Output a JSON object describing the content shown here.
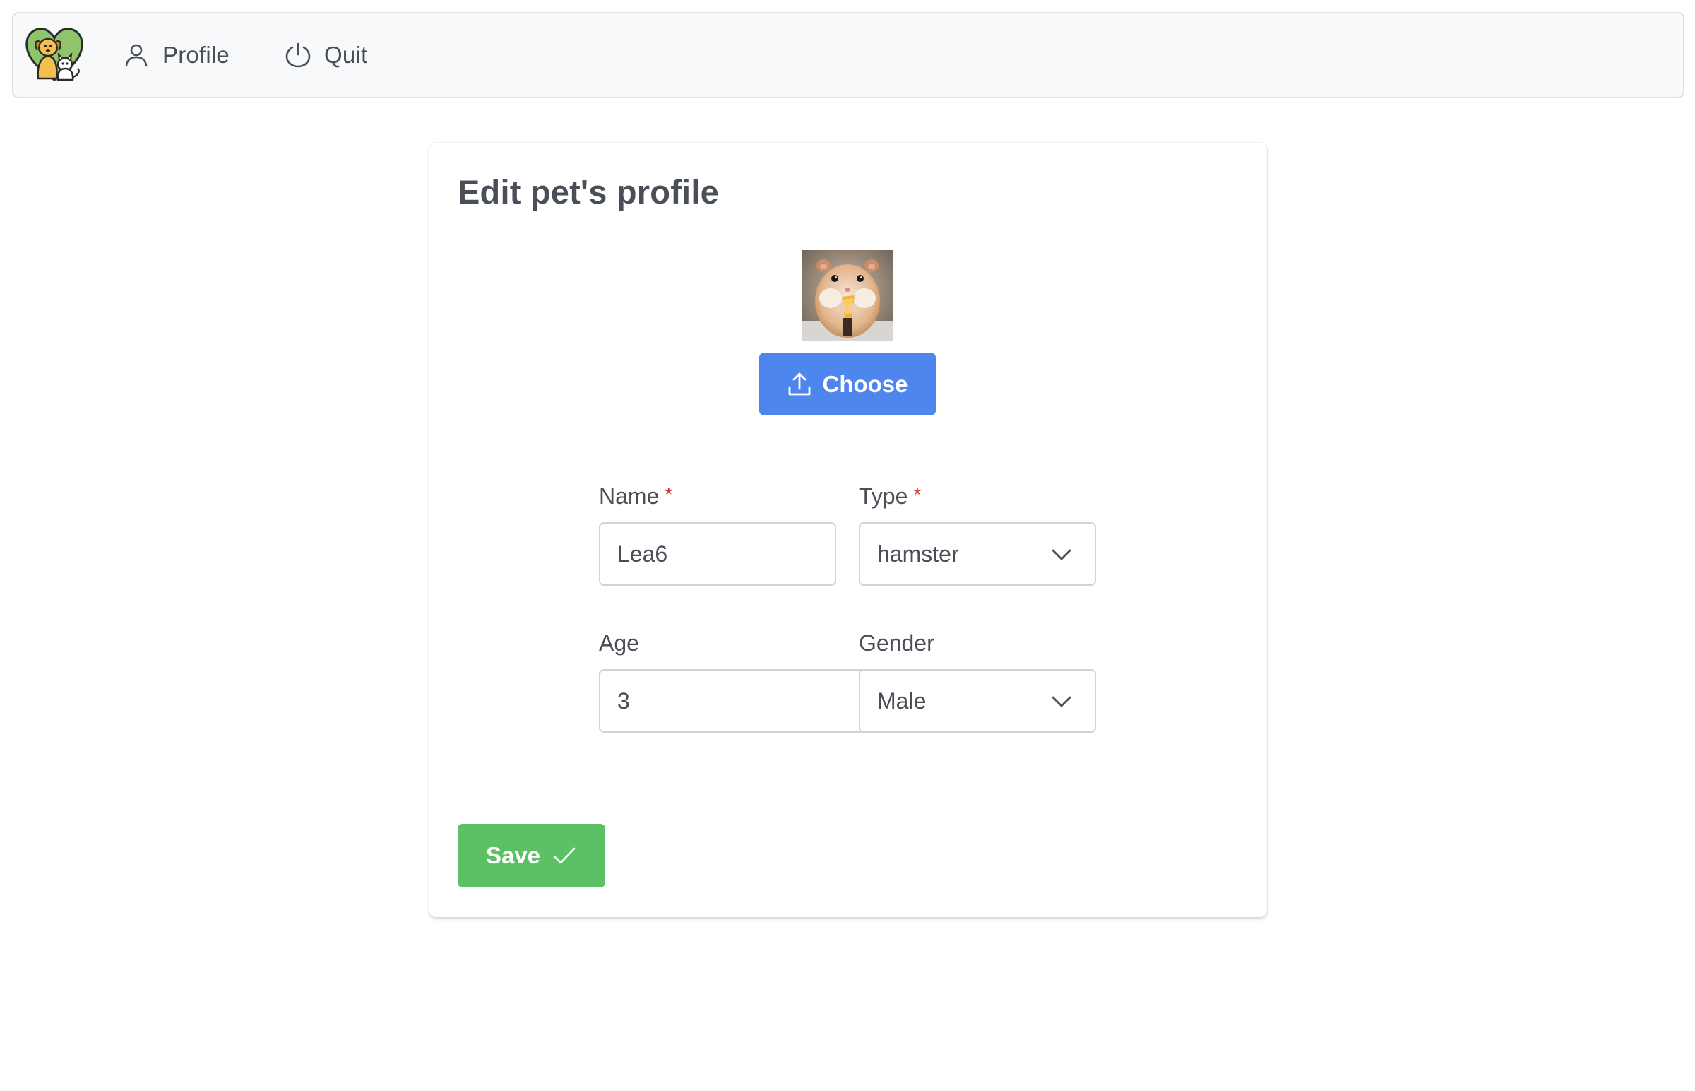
{
  "navbar": {
    "logo_icon": "dog-cat-heart-logo",
    "items": [
      {
        "label": "Profile",
        "icon": "user-icon"
      },
      {
        "label": "Quit",
        "icon": "power-icon"
      }
    ]
  },
  "card": {
    "title": "Edit pet's profile",
    "photo_icon": "hamster-photo",
    "choose_label": "Choose",
    "choose_icon": "upload-icon",
    "fields": {
      "name": {
        "label": "Name",
        "required_mark": "*",
        "value": "Lea6"
      },
      "type": {
        "label": "Type",
        "required_mark": "*",
        "value": "hamster"
      },
      "age": {
        "label": "Age",
        "value": "3"
      },
      "gender": {
        "label": "Gender",
        "value": "Male"
      }
    },
    "save_label": "Save",
    "save_icon": "check-icon"
  },
  "colors": {
    "primary": "#4f86ee",
    "success": "#5cc165",
    "required": "#d0342c",
    "navbar_bg": "#f8f9fa",
    "text": "#4a4f57"
  }
}
